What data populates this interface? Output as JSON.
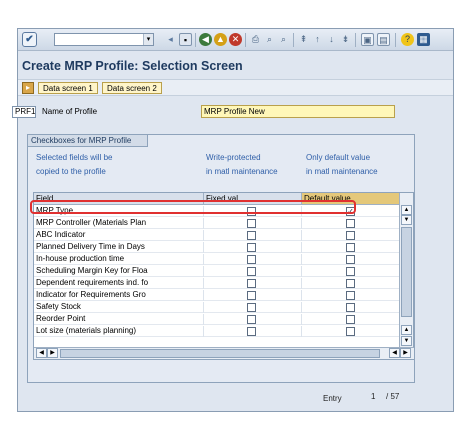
{
  "toolbar": {
    "check_icon": "check-icon",
    "command_value": ""
  },
  "page": {
    "title": "Create MRP Profile: Selection Screen"
  },
  "app_toolbar": {
    "buttons": [
      "Data screen 1",
      "Data screen 2"
    ]
  },
  "profile": {
    "code": "PRF1",
    "label": "Name of Profile",
    "value": "MRP Profile New"
  },
  "group": {
    "title": "Checkboxes for MRP Profile",
    "col1_line1": "Selected fields will be",
    "col1_line2": "copied to the profile",
    "col2_line1": "Write-protected",
    "col2_line2": "in matl maintenance",
    "col3_line1": "Only default value",
    "col3_line2": "in matl maintenance"
  },
  "table": {
    "headers": [
      "Field",
      "Fixed val.",
      "Default value"
    ],
    "rows": [
      {
        "field": "MRP Type",
        "fixed": false,
        "default": true
      },
      {
        "field": "MRP Controller (Materials Plan",
        "fixed": false,
        "default": false
      },
      {
        "field": "ABC Indicator",
        "fixed": false,
        "default": false
      },
      {
        "field": "Planned Delivery Time in Days",
        "fixed": false,
        "default": false
      },
      {
        "field": "In-house production time",
        "fixed": false,
        "default": false
      },
      {
        "field": "Scheduling Margin Key for Floa",
        "fixed": false,
        "default": false
      },
      {
        "field": "Dependent requirements ind. fo",
        "fixed": false,
        "default": false
      },
      {
        "field": "Indicator for Requirements Gro",
        "fixed": false,
        "default": false
      },
      {
        "field": "Safety Stock",
        "fixed": false,
        "default": false
      },
      {
        "field": "Reorder Point",
        "fixed": false,
        "default": false
      },
      {
        "field": "Lot size (materials planning)",
        "fixed": false,
        "default": false
      }
    ]
  },
  "status": {
    "entry_label": "Entry",
    "position": "1",
    "total": "/ 57"
  },
  "colors": {
    "title": "#1e3a5f",
    "highlight": "#e03030",
    "input_bg": "#fff7b8"
  }
}
